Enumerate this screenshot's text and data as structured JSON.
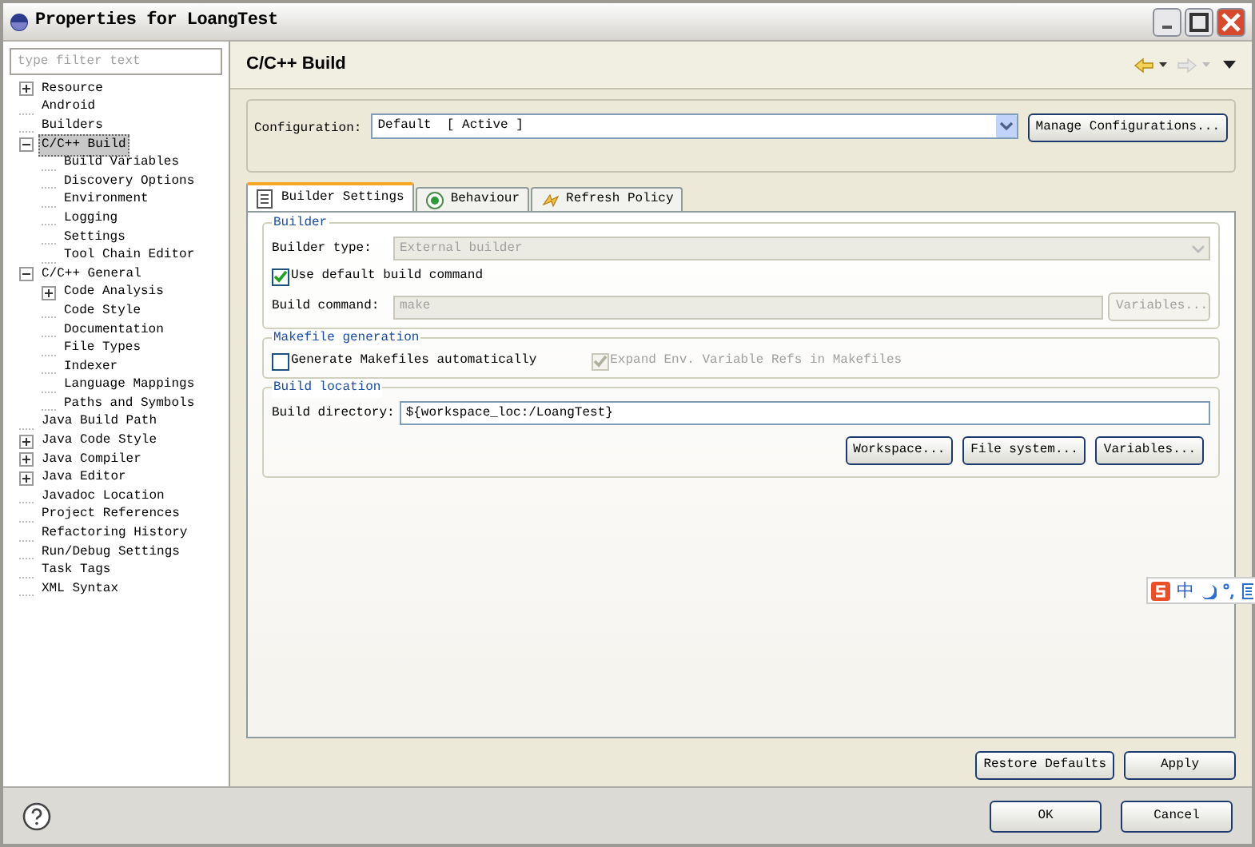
{
  "window": {
    "title": "Properties for LoangTest"
  },
  "filter": {
    "placeholder": "type filter text"
  },
  "tree": [
    {
      "label": "Resource",
      "kind": "folder",
      "expanded": false,
      "selected": false
    },
    {
      "label": "Android",
      "kind": "leaf",
      "selected": false
    },
    {
      "label": "Builders",
      "kind": "leaf",
      "selected": false
    },
    {
      "label": "C/C++ Build",
      "kind": "folder",
      "expanded": true,
      "selected": true,
      "children": [
        {
          "label": "Build Variables",
          "kind": "leaf",
          "selected": false
        },
        {
          "label": "Discovery Options",
          "kind": "leaf",
          "selected": false
        },
        {
          "label": "Environment",
          "kind": "leaf",
          "selected": false
        },
        {
          "label": "Logging",
          "kind": "leaf",
          "selected": false
        },
        {
          "label": "Settings",
          "kind": "leaf",
          "selected": false
        },
        {
          "label": "Tool Chain Editor",
          "kind": "leaf",
          "selected": false
        }
      ]
    },
    {
      "label": "C/C++ General",
      "kind": "folder",
      "expanded": true,
      "selected": false,
      "children": [
        {
          "label": "Code Analysis",
          "kind": "folder",
          "expanded": false,
          "selected": false
        },
        {
          "label": "Code Style",
          "kind": "leaf",
          "selected": false
        },
        {
          "label": "Documentation",
          "kind": "leaf",
          "selected": false
        },
        {
          "label": "File Types",
          "kind": "leaf",
          "selected": false
        },
        {
          "label": "Indexer",
          "kind": "leaf",
          "selected": false
        },
        {
          "label": "Language Mappings",
          "kind": "leaf",
          "selected": false
        },
        {
          "label": "Paths and Symbols",
          "kind": "leaf",
          "selected": false
        }
      ]
    },
    {
      "label": "Java Build Path",
      "kind": "leaf",
      "selected": false
    },
    {
      "label": "Java Code Style",
      "kind": "folder",
      "expanded": false,
      "selected": false
    },
    {
      "label": "Java Compiler",
      "kind": "folder",
      "expanded": false,
      "selected": false
    },
    {
      "label": "Java Editor",
      "kind": "folder",
      "expanded": false,
      "selected": false
    },
    {
      "label": "Javadoc Location",
      "kind": "leaf",
      "selected": false
    },
    {
      "label": "Project References",
      "kind": "leaf",
      "selected": false
    },
    {
      "label": "Refactoring History",
      "kind": "leaf",
      "selected": false
    },
    {
      "label": "Run/Debug Settings",
      "kind": "leaf",
      "selected": false
    },
    {
      "label": "Task Tags",
      "kind": "leaf",
      "selected": false
    },
    {
      "label": "XML Syntax",
      "kind": "leaf",
      "selected": false
    }
  ],
  "page": {
    "title": "C/C++ Build"
  },
  "configuration": {
    "label": "Configuration:",
    "value": "Default  [ Active ]",
    "button": "Manage Configurations..."
  },
  "tabs": [
    {
      "label": "Builder Settings",
      "selected": true
    },
    {
      "label": "Behaviour",
      "selected": false
    },
    {
      "label": "Refresh Policy",
      "selected": false
    }
  ],
  "builder": {
    "title": "Builder",
    "type_label": "Builder type:",
    "type_value": "External builder",
    "type_disabled": true,
    "use_default": {
      "label": "Use default build command",
      "checked": true,
      "disabled": false
    },
    "command_label": "Build command:",
    "command_value": "make",
    "command_disabled": true,
    "variables_button": "Variables...",
    "variables_disabled": true
  },
  "makefile": {
    "title": "Makefile generation",
    "options": [
      {
        "label": "Generate Makefiles automatically",
        "checked": false,
        "disabled": false
      },
      {
        "label": "Expand Env. Variable Refs in Makefiles",
        "checked": true,
        "disabled": true
      }
    ]
  },
  "location": {
    "title": "Build location",
    "dir_label": "Build directory:",
    "dir_value": "${workspace_loc:/LoangTest}",
    "buttons": [
      "Workspace...",
      "File system...",
      "Variables..."
    ]
  },
  "ime_toolbar": {
    "mode": "中"
  },
  "page_buttons": [
    "Restore Defaults",
    "Apply"
  ],
  "dialog_buttons": [
    "OK",
    "Cancel"
  ]
}
